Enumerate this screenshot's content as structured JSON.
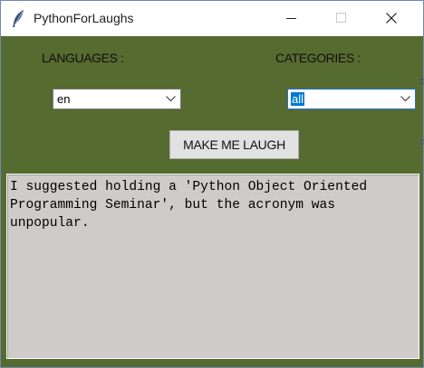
{
  "window": {
    "title": "PythonForLaughs",
    "icon": "feather-icon",
    "controls": [
      "minimize-icon",
      "maximize-icon",
      "close-icon"
    ]
  },
  "labels": {
    "languages": "LANGUAGES :",
    "categories": "CATEGORIES :"
  },
  "language_select": {
    "value": "en"
  },
  "category_select": {
    "value": "all"
  },
  "action_button": {
    "label": "MAKE ME LAUGH"
  },
  "joke_text": "I suggested holding a 'Python Object Oriented Programming Seminar', but the acronym was unpopular.",
  "colors": {
    "window_background": "#566b30",
    "text_area_background": "#cfcbca",
    "button_background": "#e1e1e1",
    "selection_highlight": "#0078d7"
  }
}
